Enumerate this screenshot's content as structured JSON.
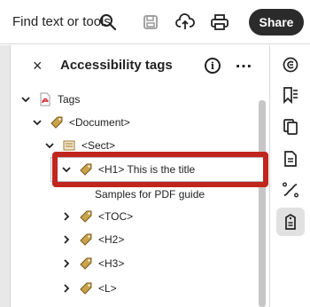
{
  "toolbar": {
    "find_label": "Find text or tools",
    "share_label": "Share",
    "icons": [
      "search-icon",
      "save-icon",
      "upload-icon",
      "print-icon"
    ]
  },
  "panel": {
    "title": "Accessibility tags",
    "info_label": "i",
    "more_label": "…",
    "close_label": "×"
  },
  "tree": {
    "rows": [
      {
        "label": "Tags",
        "icon": "pdf-icon"
      },
      {
        "label": "<Document>",
        "icon": "tag-icon"
      },
      {
        "label": "<Sect>",
        "icon": "section-icon"
      },
      {
        "label": "<H1> This is the title",
        "icon": "tag-icon"
      },
      {
        "label": "Samples for PDF guide",
        "icon": "text-icon"
      },
      {
        "label": "<TOC>",
        "icon": "tag-icon"
      },
      {
        "label": "<H2>",
        "icon": "tag-icon"
      },
      {
        "label": "<H3>",
        "icon": "tag-icon"
      },
      {
        "label": "<L>",
        "icon": "tag-icon"
      }
    ]
  },
  "right_toolbar": {
    "icons": [
      "comment-icon",
      "bookmark-icon",
      "pages-icon",
      "document-icon",
      "tools-icon",
      "accessibility-tags-icon"
    ],
    "active": "accessibility-tags-icon"
  },
  "colors": {
    "highlight_border": "#c0261d",
    "share_bg": "#2b2b2b",
    "tag_icon": "#c9a24a",
    "pdf_red": "#d6262f"
  }
}
